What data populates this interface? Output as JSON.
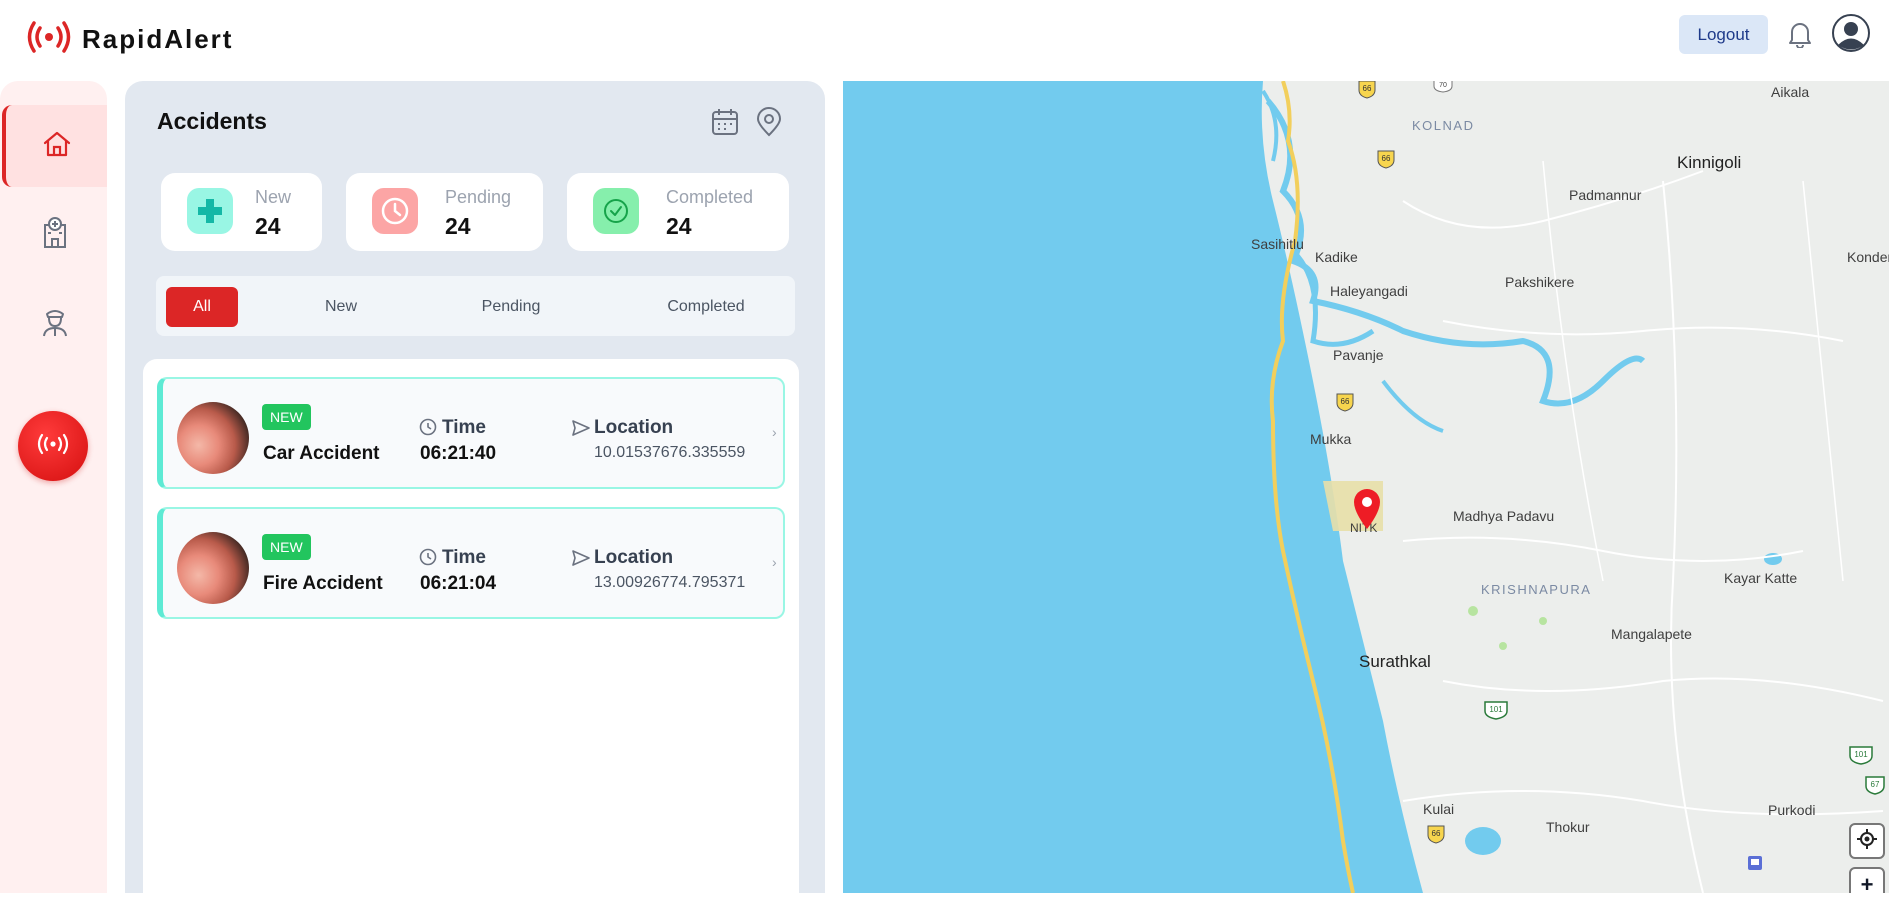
{
  "app": {
    "name": "RapidAlert",
    "logout_label": "Logout"
  },
  "sidebar": {
    "items": [
      {
        "icon": "home-icon",
        "active": true
      },
      {
        "icon": "hospital-icon",
        "active": false
      },
      {
        "icon": "officer-icon",
        "active": false
      }
    ],
    "sos_icon": "broadcast-icon"
  },
  "accidents": {
    "title": "Accidents",
    "stats": [
      {
        "label": "New",
        "value": "24",
        "color": "#5eead4"
      },
      {
        "label": "Pending",
        "value": "24",
        "color": "#fca5a5"
      },
      {
        "label": "Completed",
        "value": "24",
        "color": "#86efac"
      }
    ],
    "tabs": [
      {
        "label": "All",
        "active": true
      },
      {
        "label": "New",
        "active": false
      },
      {
        "label": "Pending",
        "active": false
      },
      {
        "label": "Completed",
        "active": false
      }
    ],
    "items": [
      {
        "badge": "NEW",
        "title": "Car Accident",
        "time_label": "Time",
        "time": "06:21:40",
        "location_label": "Location",
        "location": "10.01537676.335559"
      },
      {
        "badge": "NEW",
        "title": "Fire Accident",
        "time_label": "Time",
        "time": "06:21:04",
        "location_label": "Location",
        "location": "13.00926774.795371"
      }
    ]
  },
  "map": {
    "places": [
      "KOLNAD",
      "Aikala",
      "Kinnigoli",
      "Padmannur",
      "Sasihitlu",
      "Kadike",
      "Kondem",
      "Haleyangadi",
      "Pakshikere",
      "Pavanje",
      "Mukka",
      "NITK",
      "Madhya Padavu",
      "KRISHNAPURA",
      "Kayar Katte",
      "Mangalapete",
      "Surathkal",
      "Kulai",
      "Thokur",
      "Purkodi"
    ],
    "highway_66": "66",
    "highway_101": "101",
    "highway_67": "67",
    "highway_70": "70",
    "zoom_in": "+"
  },
  "colors": {
    "accent": "#dc2626",
    "water": "#72cbee",
    "new_badge": "#22c55e"
  }
}
